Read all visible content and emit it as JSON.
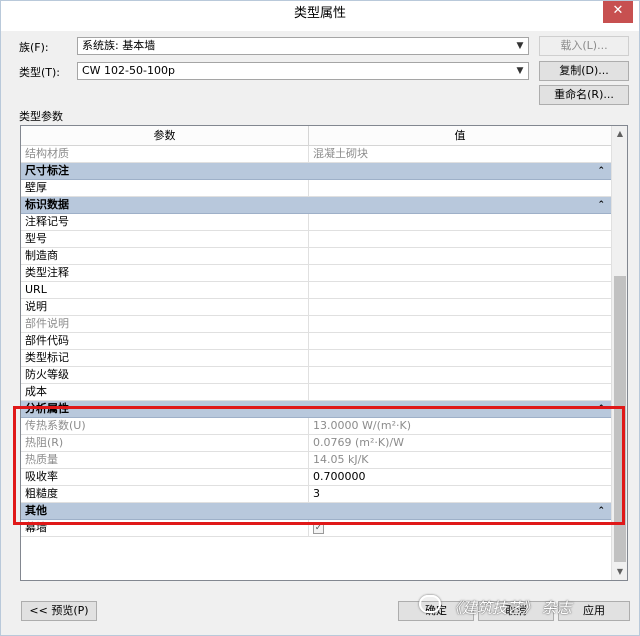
{
  "window": {
    "title": "类型属性",
    "close_glyph": "✕"
  },
  "family": {
    "label": "族(F):",
    "value": "系统族: 基本墙",
    "load_button": "载入(L)..."
  },
  "type": {
    "label": "类型(T):",
    "value": "CW 102-50-100p",
    "duplicate_button": "复制(D)...",
    "rename_button": "重命名(R)..."
  },
  "section_label": "类型参数",
  "grid": {
    "col_param": "参数",
    "col_value": "值",
    "rows": [
      {
        "kind": "row",
        "param": "结构材质",
        "value": "混凝土砌块",
        "gray": true
      },
      {
        "kind": "group",
        "param": "尺寸标注"
      },
      {
        "kind": "row",
        "param": "壁厚",
        "value": ""
      },
      {
        "kind": "group",
        "param": "标识数据"
      },
      {
        "kind": "row",
        "param": "注释记号",
        "value": ""
      },
      {
        "kind": "row",
        "param": "型号",
        "value": ""
      },
      {
        "kind": "row",
        "param": "制造商",
        "value": ""
      },
      {
        "kind": "row",
        "param": "类型注释",
        "value": ""
      },
      {
        "kind": "row",
        "param": "URL",
        "value": ""
      },
      {
        "kind": "row",
        "param": "说明",
        "value": ""
      },
      {
        "kind": "row",
        "param": "部件说明",
        "value": "",
        "gray": true
      },
      {
        "kind": "row",
        "param": "部件代码",
        "value": ""
      },
      {
        "kind": "row",
        "param": "类型标记",
        "value": ""
      },
      {
        "kind": "row",
        "param": "防火等级",
        "value": ""
      },
      {
        "kind": "row",
        "param": "成本",
        "value": ""
      },
      {
        "kind": "group",
        "param": "分析属性"
      },
      {
        "kind": "row",
        "param": "传热系数(U)",
        "value": "13.0000 W/(m²·K)",
        "gray": true
      },
      {
        "kind": "row",
        "param": "热阻(R)",
        "value": "0.0769 (m²·K)/W",
        "gray": true
      },
      {
        "kind": "row",
        "param": "热质量",
        "value": "14.05 kJ/K",
        "gray": true
      },
      {
        "kind": "row",
        "param": "吸收率",
        "value": "0.700000"
      },
      {
        "kind": "row",
        "param": "粗糙度",
        "value": "3"
      },
      {
        "kind": "group",
        "param": "其他"
      },
      {
        "kind": "row",
        "param": "幕墙",
        "value": "",
        "checkbox": true,
        "checked": true
      }
    ],
    "collapse_glyph": "⌃"
  },
  "footer": {
    "preview_button": "<< 预览(P)",
    "ok_button": "确定",
    "cancel_button": "取消",
    "apply_button": "应用"
  },
  "watermark": "《建筑技艺》 杂志",
  "colors": {
    "group_header": "#b8c8dc",
    "highlight_box": "#e01818",
    "close_button": "#c75050"
  }
}
